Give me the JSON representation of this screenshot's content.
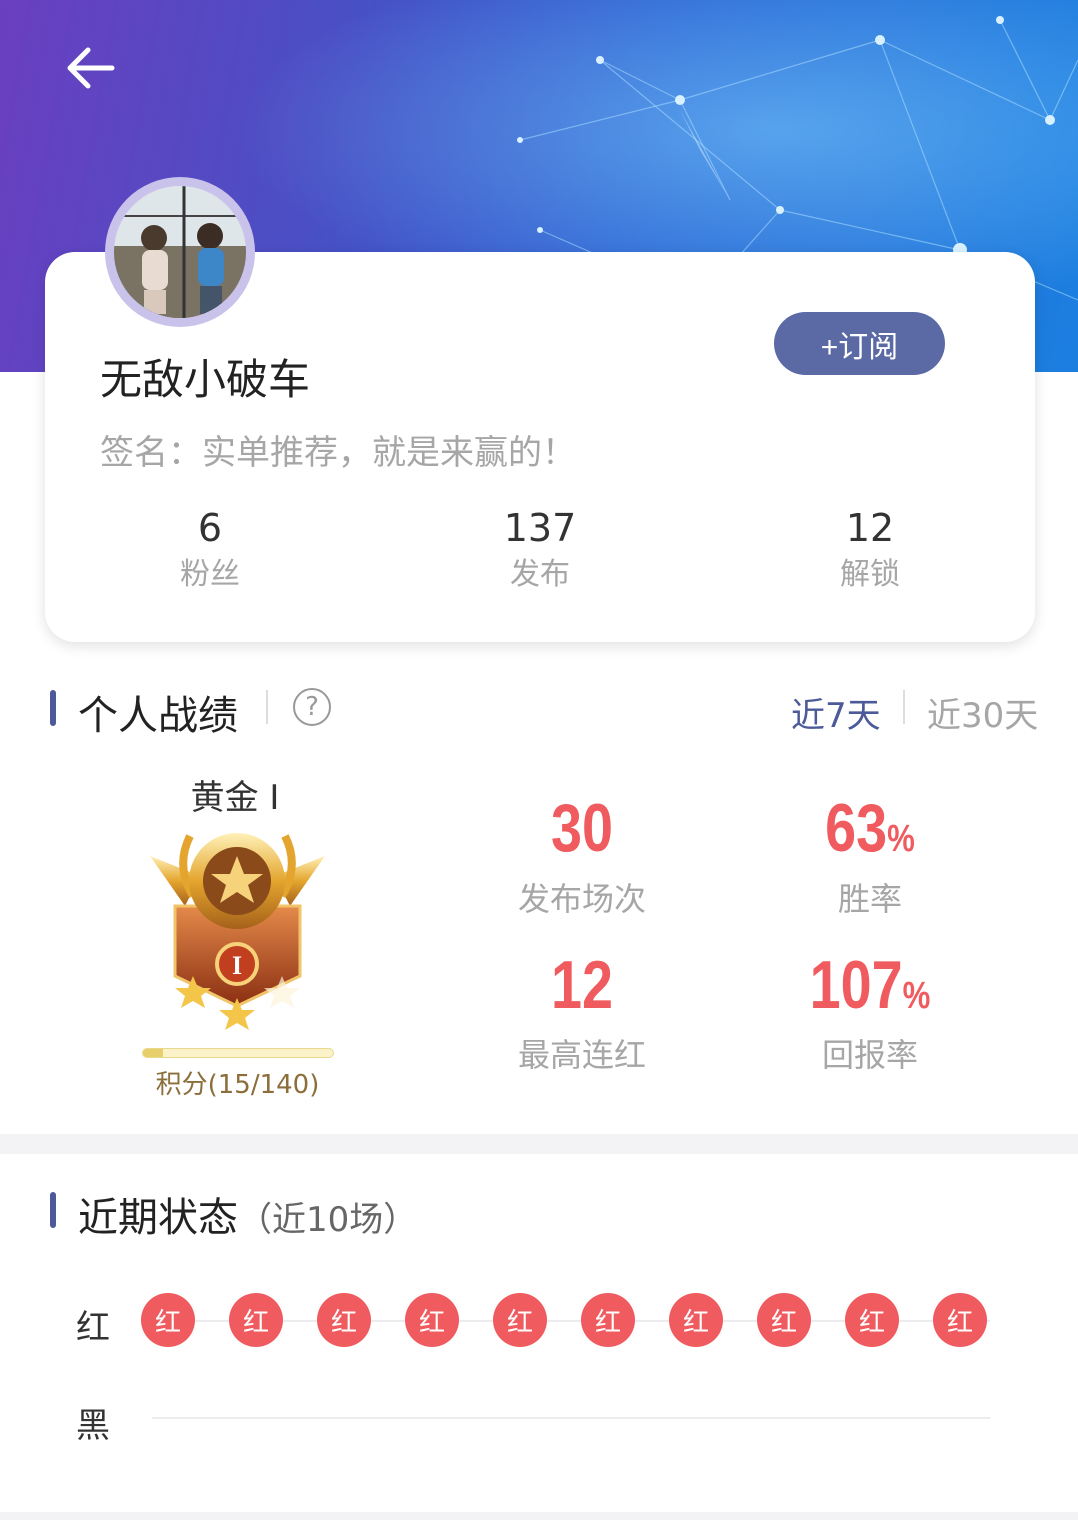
{
  "header": {
    "back_icon": "arrow-left-icon"
  },
  "profile": {
    "username": "无敌小破车",
    "subscribe_label": "+订阅",
    "signature": "签名：实单推荐，就是来赢的！",
    "stats": [
      {
        "value": "6",
        "label": "粉丝"
      },
      {
        "value": "137",
        "label": "发布"
      },
      {
        "value": "12",
        "label": "解锁"
      }
    ]
  },
  "record": {
    "title": "个人战绩",
    "help_icon": "question-circle-icon",
    "periods": [
      {
        "label": "近7天",
        "active": true
      },
      {
        "label": "近30天",
        "active": false
      }
    ],
    "rank": {
      "name": "黄金 I",
      "badge_icon": "gold-rank-badge-icon",
      "badge_numeral": "I",
      "points_label": "积分(15/140)",
      "points_current": 15,
      "points_max": 140
    },
    "metrics": [
      {
        "value": "30",
        "unit": "",
        "label": "发布场次"
      },
      {
        "value": "63",
        "unit": "%",
        "label": "胜率"
      },
      {
        "value": "12",
        "unit": "",
        "label": "最高连红"
      },
      {
        "value": "107",
        "unit": "%",
        "label": "回报率"
      }
    ]
  },
  "recent": {
    "title": "近期状态",
    "hint": "（近10场）",
    "rows": [
      {
        "label": "红",
        "results": [
          "红",
          "红",
          "红",
          "红",
          "红",
          "红",
          "红",
          "红",
          "红",
          "红"
        ]
      },
      {
        "label": "黑",
        "results": []
      }
    ]
  },
  "colors": {
    "accent": "#5b6aa5",
    "red": "#ef5b5f",
    "muted": "#a6a6a6"
  }
}
